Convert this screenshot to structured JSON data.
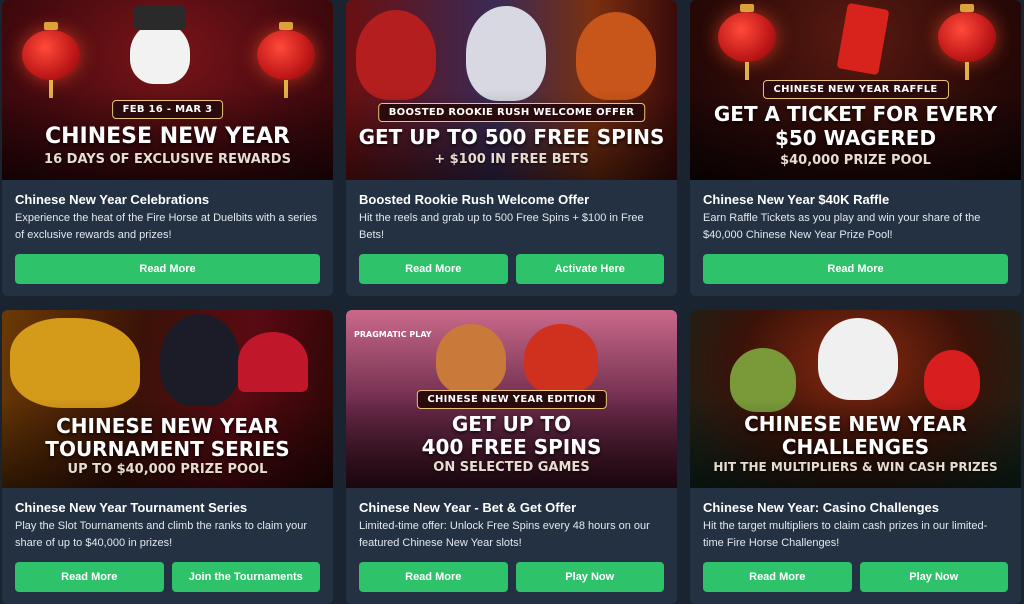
{
  "cards": [
    {
      "badge": "FEB 16 - MAR 3",
      "headline": "CHINESE NEW YEAR",
      "headline2": "",
      "subline": "16 DAYS OF EXCLUSIVE REWARDS",
      "title": "Chinese New Year Celebrations",
      "description": "Experience the heat of the Fire Horse at Duelbits with a series of exclusive rewards and prizes!",
      "buttons": [
        "Read More"
      ]
    },
    {
      "badge": "BOOSTED ROOKIE RUSH WELCOME OFFER",
      "headline": "GET UP TO 500 FREE SPINS",
      "headline2": "",
      "subline": "+ $100 IN FREE BETS",
      "title": "Boosted Rookie Rush Welcome Offer",
      "description": "Hit the reels and grab up to 500 Free Spins + $100 in Free Bets!",
      "buttons": [
        "Read More",
        "Activate Here"
      ]
    },
    {
      "badge": "CHINESE NEW YEAR RAFFLE",
      "headline": "GET A TICKET FOR EVERY",
      "headline2": "$50 WAGERED",
      "subline": "$40,000 PRIZE POOL",
      "title": "Chinese New Year $40K Raffle",
      "description": "Earn Raffle Tickets as you play and win your share of the $40,000 Chinese New Year Prize Pool!",
      "buttons": [
        "Read More"
      ]
    },
    {
      "badge": "",
      "headline": "CHINESE NEW YEAR",
      "headline2": "TOURNAMENT SERIES",
      "subline": "UP TO $40,000 PRIZE POOL",
      "title": "Chinese New Year Tournament Series",
      "description": "Play the Slot Tournaments and climb the ranks to claim your share of up to $40,000 in prizes!",
      "buttons": [
        "Read More",
        "Join the Tournaments"
      ]
    },
    {
      "provider": "PRAGMATIC PLAY",
      "badge": "CHINESE NEW YEAR EDITION",
      "headline": "GET UP TO",
      "headline2": "400 FREE SPINS",
      "subline": "ON SELECTED GAMES",
      "title": "Chinese New Year - Bet & Get Offer",
      "description": "Limited-time offer: Unlock Free Spins every 48 hours on our featured Chinese New Year slots!",
      "buttons": [
        "Read More",
        "Play Now"
      ]
    },
    {
      "badge": "",
      "headline": "CHINESE NEW YEAR",
      "headline2": "CHALLENGES",
      "subline": "HIT THE MULTIPLIERS & WIN CASH PRIZES",
      "title": "Chinese New Year: Casino Challenges",
      "description": "Hit the target multipliers to claim cash prizes in our limited-time Fire Horse Challenges!",
      "buttons": [
        "Read More",
        "Play Now"
      ]
    }
  ],
  "colors": {
    "button": "#2ec36a",
    "card": "#233142",
    "background": "#1a2430"
  }
}
